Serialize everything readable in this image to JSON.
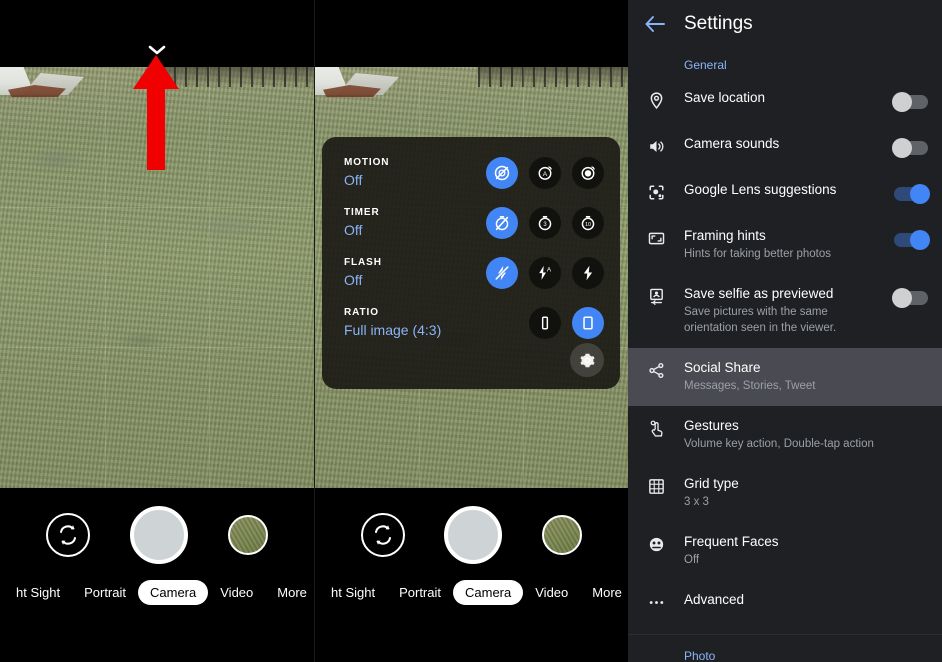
{
  "camera": {
    "chevron_icon": "chevron-down-icon",
    "annotation_icon": "red-up-arrow-annotation",
    "annotation_color": "#f00000",
    "quick_settings": {
      "rows": [
        {
          "label": "MOTION",
          "value": "Off",
          "options": [
            {
              "icon": "motion-off-icon",
              "selected": true
            },
            {
              "icon": "motion-auto-icon",
              "selected": false
            },
            {
              "icon": "motion-on-icon",
              "selected": false
            }
          ]
        },
        {
          "label": "TIMER",
          "value": "Off",
          "options": [
            {
              "icon": "timer-off-icon",
              "selected": true
            },
            {
              "icon": "timer-3s-icon",
              "selected": false
            },
            {
              "icon": "timer-10s-icon",
              "selected": false
            }
          ]
        },
        {
          "label": "FLASH",
          "value": "Off",
          "options": [
            {
              "icon": "flash-off-icon",
              "selected": true
            },
            {
              "icon": "flash-auto-icon",
              "selected": false
            },
            {
              "icon": "flash-on-icon",
              "selected": false
            }
          ]
        },
        {
          "label": "RATIO",
          "value": "Full image (4:3)",
          "options": [
            {
              "icon": "ratio-16-9-icon",
              "selected": false
            },
            {
              "icon": "ratio-4-3-icon",
              "selected": true
            }
          ]
        }
      ],
      "gear_icon": "gear-icon",
      "accent": "#4285f4",
      "value_color": "#8ab4f8"
    },
    "controls": {
      "flip_icon": "camera-flip-icon",
      "shutter_label": "shutter-button",
      "thumbnail_label": "last-photo-thumbnail"
    },
    "modes": [
      {
        "label": "ht Sight",
        "active": false
      },
      {
        "label": "Portrait",
        "active": false
      },
      {
        "label": "Camera",
        "active": true
      },
      {
        "label": "Video",
        "active": false
      },
      {
        "label": "More",
        "active": false
      }
    ]
  },
  "settings": {
    "back_icon": "back-arrow-icon",
    "title": "Settings",
    "section_label": "General",
    "footer_label": "Photo",
    "accent": "#8ab4f8",
    "items": [
      {
        "icon": "location-pin-icon",
        "name": "Save location",
        "sub": "",
        "toggle": "off",
        "highlight": false
      },
      {
        "icon": "speaker-icon",
        "name": "Camera sounds",
        "sub": "",
        "toggle": "off",
        "highlight": false
      },
      {
        "icon": "google-lens-icon",
        "name": "Google Lens suggestions",
        "sub": "",
        "toggle": "on",
        "highlight": false
      },
      {
        "icon": "framing-hints-icon",
        "name": "Framing hints",
        "sub": "Hints for taking better photos",
        "toggle": "on",
        "highlight": false
      },
      {
        "icon": "selfie-orientation-icon",
        "name": "Save selfie as previewed",
        "sub": "Save pictures with the same orientation seen in the viewer.",
        "toggle": "off",
        "highlight": false
      },
      {
        "icon": "share-icon",
        "name": "Social Share",
        "sub": "Messages, Stories, Tweet",
        "toggle": "none",
        "highlight": true
      },
      {
        "icon": "gesture-tap-icon",
        "name": "Gestures",
        "sub": "Volume key action, Double-tap action",
        "toggle": "none",
        "highlight": false
      },
      {
        "icon": "grid-icon",
        "name": "Grid type",
        "sub": "3 x 3",
        "toggle": "none",
        "highlight": false
      },
      {
        "icon": "frequent-faces-icon",
        "name": "Frequent Faces",
        "sub": "Off",
        "toggle": "none",
        "highlight": false
      },
      {
        "icon": "more-dots-icon",
        "name": "Advanced",
        "sub": "",
        "toggle": "none",
        "highlight": false
      }
    ]
  }
}
